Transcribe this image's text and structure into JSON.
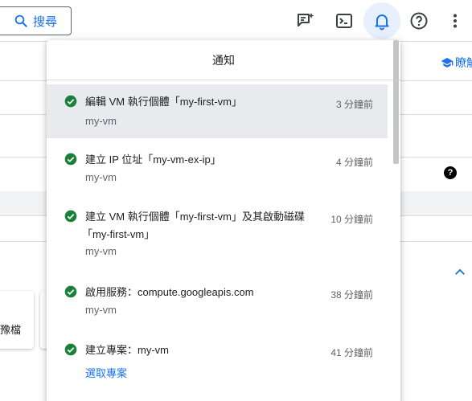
{
  "topbar": {
    "search_label": "搜尋",
    "icons": [
      "assistant-icon",
      "cloud-shell-icon",
      "notifications-icon",
      "help-icon",
      "more-vert-icon"
    ]
  },
  "background": {
    "learn_link": "瞭解",
    "card_text": "豫檔",
    "help_badge": "?"
  },
  "panel": {
    "title": "通知",
    "notifications": [
      {
        "message": "編輯 VM 執行個體「my-first-vm」",
        "time": "3 分鐘前",
        "sub": "my-vm",
        "sub_is_link": false
      },
      {
        "message": "建立 IP 位址「my-vm-ex-ip」",
        "time": "4 分鐘前",
        "sub": "my-vm",
        "sub_is_link": false
      },
      {
        "message_line1": "建立 VM 執行個體「my-first-vm」及其啟動磁碟",
        "message_line2": "「my-first-vm」",
        "time": "10 分鐘前",
        "sub": "my-vm",
        "sub_is_link": false
      },
      {
        "message": "啟用服務：compute.googleapis.com",
        "time": "38 分鐘前",
        "sub": "my-vm",
        "sub_is_link": false
      },
      {
        "message": "建立專案：my-vm",
        "time": "41 分鐘前",
        "sub": "選取專案",
        "sub_is_link": true
      }
    ]
  },
  "colors": {
    "accent": "#1a73e8",
    "success": "#188038",
    "highlight": "#e8eaed"
  }
}
